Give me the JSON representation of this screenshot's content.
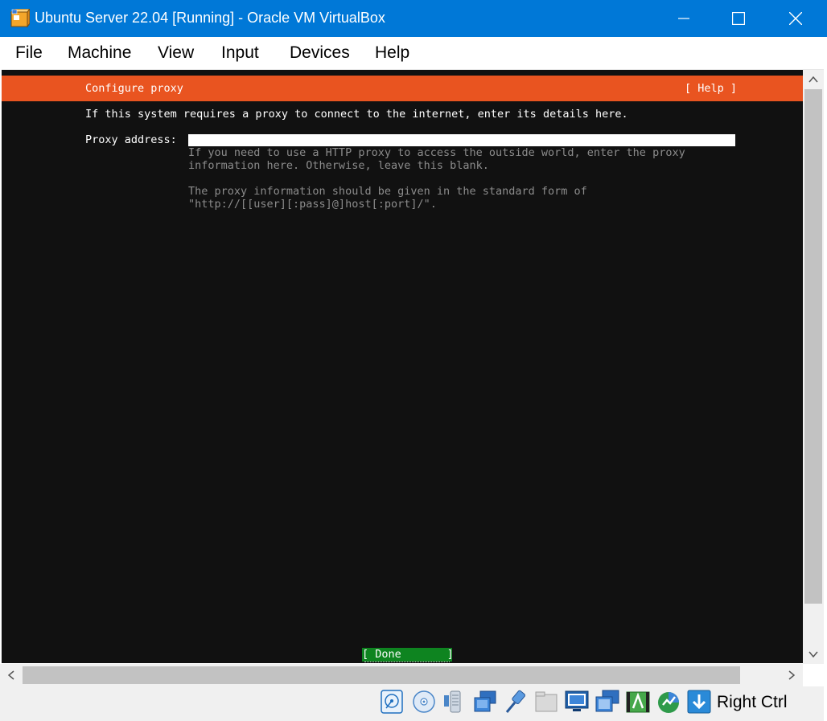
{
  "window": {
    "title": "Ubuntu Server 22.04 [Running] - Oracle VM VirtualBox",
    "accent_color": "#0078d7"
  },
  "menu": {
    "items": [
      "File",
      "Machine",
      "View",
      "Input",
      "Devices",
      "Help"
    ]
  },
  "installer": {
    "header_title": "Configure proxy",
    "header_help": "[ Help ]",
    "header_color": "#e95420",
    "intro": "If this system requires a proxy to connect to the internet, enter its details here.",
    "proxy_label": "Proxy address:",
    "proxy_value": "",
    "help_line_1": "If you need to use a HTTP proxy to access the outside world, enter the proxy",
    "help_line_2": "information here. Otherwise, leave this blank.",
    "help_line_3": "The proxy information should be given in the standard form of",
    "help_line_4": "\"http://[[user][:pass]@]host[:port]/\".",
    "done_label": "[ Done       ]",
    "done_color": "#0e8420"
  },
  "statusbar": {
    "icons": [
      "hard-disk-icon",
      "optical-drive-icon",
      "audio-icon",
      "network-icon",
      "usb-icon",
      "shared-folders-icon",
      "display-icon",
      "video-capture-icon",
      "recording-icon",
      "mouse-integration-icon",
      "keyboard-capture-icon"
    ],
    "host_key": "Right Ctrl"
  }
}
